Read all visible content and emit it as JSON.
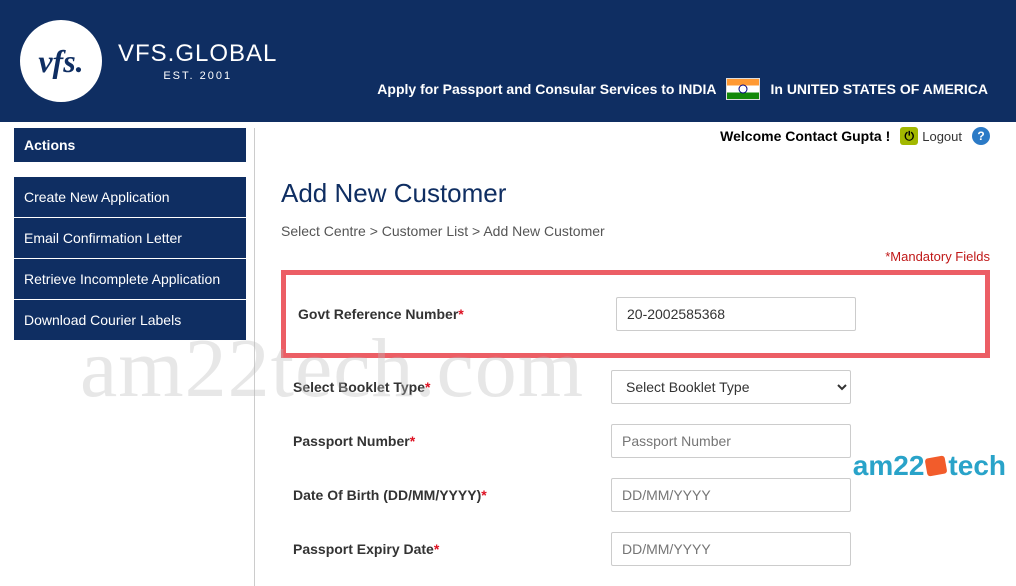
{
  "brand": {
    "name": "VFS.GLOBAL",
    "est": "EST. 2001",
    "logo": "vfs."
  },
  "header": {
    "apply_prefix": "Apply for Passport and Consular Services to INDIA",
    "apply_suffix": "In UNITED STATES OF AMERICA"
  },
  "sidebar": {
    "header": "Actions",
    "items": [
      {
        "label": "Create New Application"
      },
      {
        "label": "Email Confirmation Letter"
      },
      {
        "label": "Retrieve Incomplete Application"
      },
      {
        "label": "Download Courier Labels"
      }
    ]
  },
  "top": {
    "welcome": "Welcome Contact Gupta !",
    "logout": "Logout"
  },
  "page": {
    "title": "Add New Customer",
    "breadcrumb": "Select Centre   >   Customer List   >   Add New Customer",
    "mandatory": "*Mandatory Fields"
  },
  "form": {
    "govt_ref": {
      "label": "Govt Reference Number",
      "value": "20-2002585368"
    },
    "booklet": {
      "label": "Select Booklet Type",
      "placeholder": "Select Booklet Type"
    },
    "passport": {
      "label": "Passport Number",
      "placeholder": "Passport Number"
    },
    "dob": {
      "label": "Date Of Birth (DD/MM/YYYY)",
      "placeholder": "DD/MM/YYYY"
    },
    "expiry": {
      "label": "Passport Expiry Date",
      "placeholder": "DD/MM/YYYY"
    }
  },
  "watermark": {
    "big": "am22tech.com",
    "small_a": "am22",
    "small_b": "tech"
  }
}
